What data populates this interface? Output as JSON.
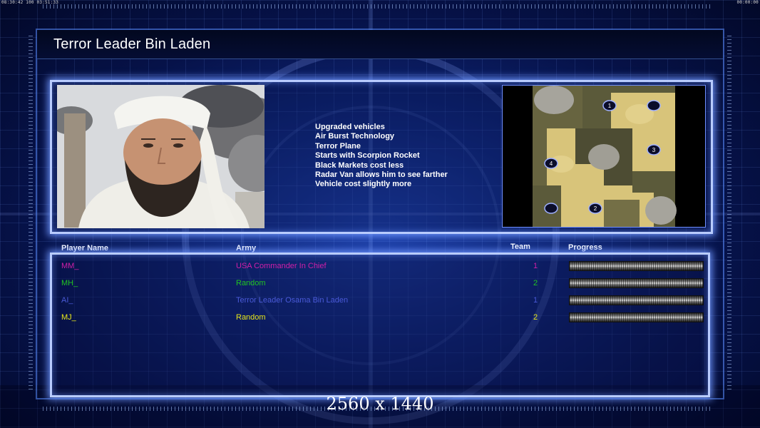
{
  "status_bar": {
    "left_text": "08:30:42 100 03:51:33",
    "right_text": "00:00:00"
  },
  "title": "Terror Leader Bin Laden",
  "general": {
    "portrait_icon": "general-portrait",
    "features": [
      "Upgraded vehicles",
      "Air Burst Technology",
      "Terror Plane",
      "Starts with Scorpion Rocket",
      "Black Markets cost less",
      "Radar Van allows him to see farther",
      "Vehicle cost slightly more"
    ]
  },
  "map": {
    "start_positions": [
      "1",
      "2",
      "3",
      "4",
      "",
      ""
    ]
  },
  "table": {
    "headers": {
      "player_name": "Player Name",
      "army": "Army",
      "team": "Team",
      "progress": "Progress"
    },
    "players": [
      {
        "name": "MM_",
        "army": "USA Commander In Chief",
        "team": "1",
        "color": "#d21fa8",
        "progress": 0
      },
      {
        "name": "MH_",
        "army": "Random",
        "team": "2",
        "color": "#22c422",
        "progress": 0
      },
      {
        "name": "AI_",
        "army": "Terror Leader Osama Bin Laden",
        "team": "1",
        "color": "#4a5ad8",
        "progress": 0
      },
      {
        "name": "MJ_",
        "army": "Random",
        "team": "2",
        "color": "#e6e61a",
        "progress": 0
      }
    ]
  },
  "resolution_label": "2560 x 1440"
}
